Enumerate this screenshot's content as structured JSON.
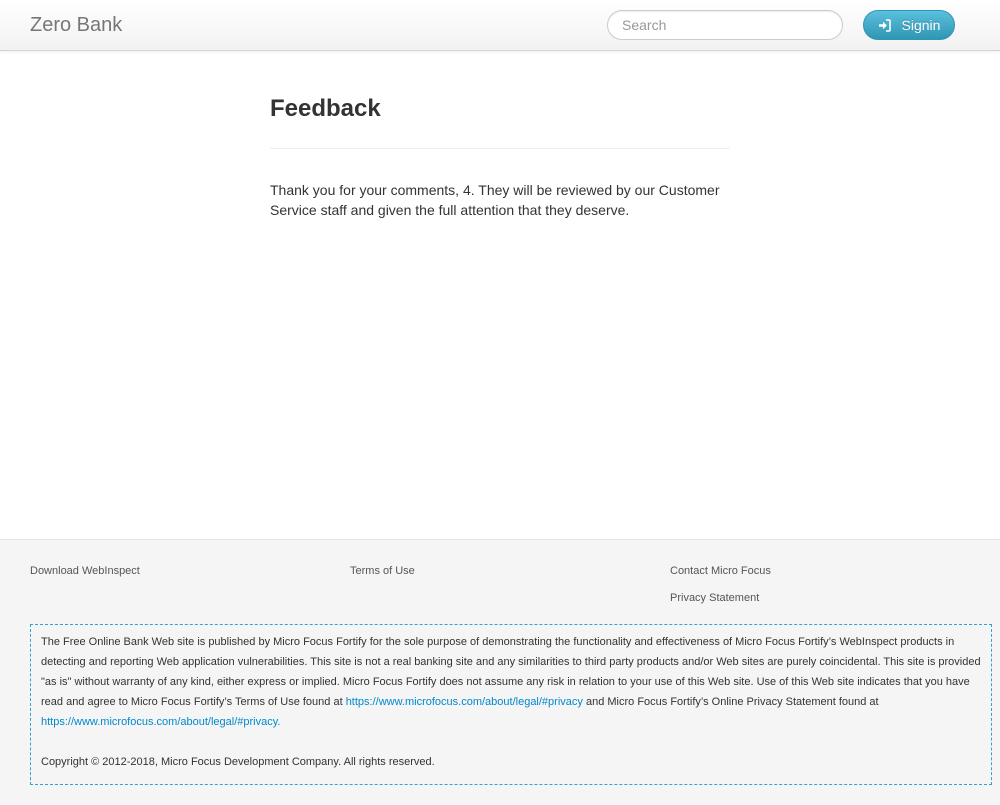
{
  "navbar": {
    "brand": "Zero Bank",
    "search_placeholder": "Search",
    "signin_label": "Signin"
  },
  "main": {
    "title": "Feedback",
    "message": "Thank you for your comments, 4. They will be reviewed by our Customer Service staff and given the full attention that they deserve."
  },
  "footer": {
    "links": {
      "download": "Download WebInspect",
      "terms": "Terms of Use",
      "contact": "Contact Micro Focus",
      "privacy": "Privacy Statement"
    },
    "disclaimer": {
      "part1": "The Free Online Bank Web site is published by Micro Focus Fortify for the sole purpose of demonstrating the functionality and effectiveness of Micro Focus Fortify’s WebInspect products in detecting and reporting Web application vulnerabilities. This site is not a real banking site and any similarities to third party products and/or Web sites are purely coincidental. This site is provided \"as is\" without warranty of any kind, either express or implied. Micro Focus Fortify does not assume any risk in relation to your use of this Web site. Use of this Web site indicates that you have read and agree to Micro Focus Fortify’s Terms of Use found at ",
      "link1": "https://www.microfocus.com/about/legal/#privacy",
      "part2": " and Micro Focus Fortify’s Online Privacy Statement found at ",
      "link2": "https://www.microfocus.com/about/legal/#privacy.",
      "copyright": "Copyright © 2012-2018, Micro Focus Development Company. All rights reserved."
    }
  },
  "colors": {
    "accent": "#5bc0de",
    "link": "#0088cc",
    "dashed_border": "#2ea5c9"
  },
  "icons": {
    "signin": "sign-in-icon"
  }
}
